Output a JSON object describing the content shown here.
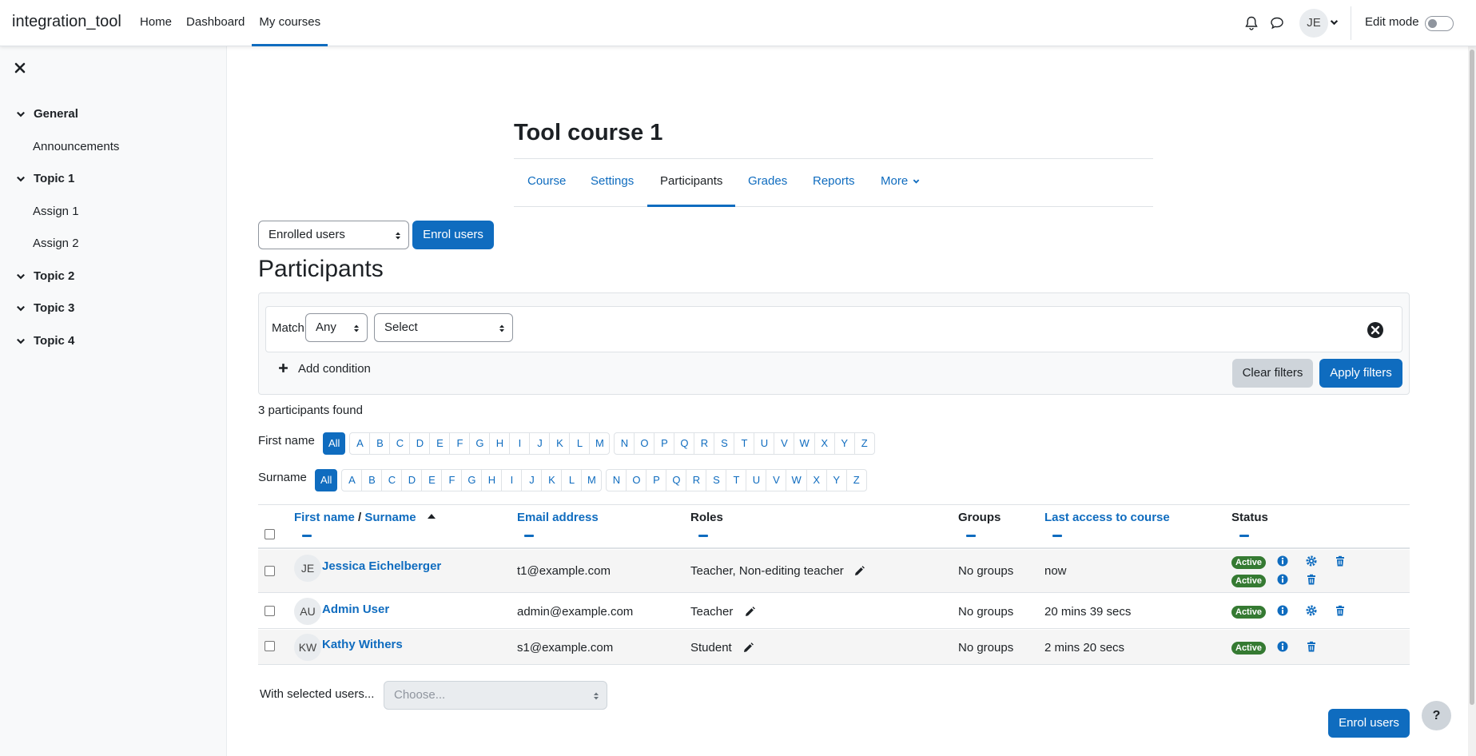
{
  "navbar": {
    "brand": "integration_tool",
    "items": [
      {
        "label": "Home",
        "active": false
      },
      {
        "label": "Dashboard",
        "active": false
      },
      {
        "label": "My courses",
        "active": true
      }
    ],
    "user_initials": "JE",
    "edit_mode_label": "Edit mode"
  },
  "drawer": {
    "sections": [
      {
        "label": "General",
        "items": [
          "Announcements"
        ]
      },
      {
        "label": "Topic 1",
        "items": [
          "Assign 1",
          "Assign 2"
        ]
      },
      {
        "label": "Topic 2",
        "items": []
      },
      {
        "label": "Topic 3",
        "items": []
      },
      {
        "label": "Topic 4",
        "items": []
      }
    ]
  },
  "course": {
    "title": "Tool course 1",
    "tabs": [
      {
        "label": "Course",
        "active": false
      },
      {
        "label": "Settings",
        "active": false
      },
      {
        "label": "Participants",
        "active": true
      },
      {
        "label": "Grades",
        "active": false
      },
      {
        "label": "Reports",
        "active": false
      },
      {
        "label": "More",
        "active": false
      }
    ]
  },
  "participants": {
    "enrolment_select": "Enrolled users",
    "enrol_button": "Enrol users",
    "heading": "Participants",
    "filter": {
      "match_label": "Match",
      "match_value": "Any",
      "condition_value": "Select",
      "add_condition": "Add condition",
      "clear": "Clear filters",
      "apply": "Apply filters"
    },
    "count_text": "3 participants found",
    "firstname_label": "First name",
    "surname_label": "Surname",
    "letters_all": "All",
    "letters_a_m": [
      "A",
      "B",
      "C",
      "D",
      "E",
      "F",
      "G",
      "H",
      "I",
      "J",
      "K",
      "L",
      "M"
    ],
    "letters_n_z": [
      "N",
      "O",
      "P",
      "Q",
      "R",
      "S",
      "T",
      "U",
      "V",
      "W",
      "X",
      "Y",
      "Z"
    ],
    "columns": {
      "firstname": "First name",
      "slash": " / ",
      "surname": "Surname",
      "email": "Email address",
      "roles": "Roles",
      "groups": "Groups",
      "last_access": "Last access to course",
      "status": "Status"
    },
    "rows": [
      {
        "initials": "JE",
        "name": "Jessica Eichelberger",
        "email": "t1@example.com",
        "roles": "Teacher, Non-editing teacher",
        "groups": "No groups",
        "last_access": "now",
        "status": [
          "Active",
          "Active"
        ]
      },
      {
        "initials": "AU",
        "name": "Admin User",
        "email": "admin@example.com",
        "roles": "Teacher",
        "groups": "No groups",
        "last_access": "20 mins 39 secs",
        "status": [
          "Active"
        ]
      },
      {
        "initials": "KW",
        "name": "Kathy Withers",
        "email": "s1@example.com",
        "roles": "Student",
        "groups": "No groups",
        "last_access": "2 mins 20 secs",
        "status": [
          "Active"
        ]
      }
    ],
    "bulk_label": "With selected users...",
    "bulk_placeholder": "Choose...",
    "enrol_button_bottom": "Enrol users"
  },
  "help_label": "?",
  "colors": {
    "primary": "#0f6cbf",
    "success": "#357a32",
    "border": "#dee2e6",
    "text": "#1d2125"
  }
}
